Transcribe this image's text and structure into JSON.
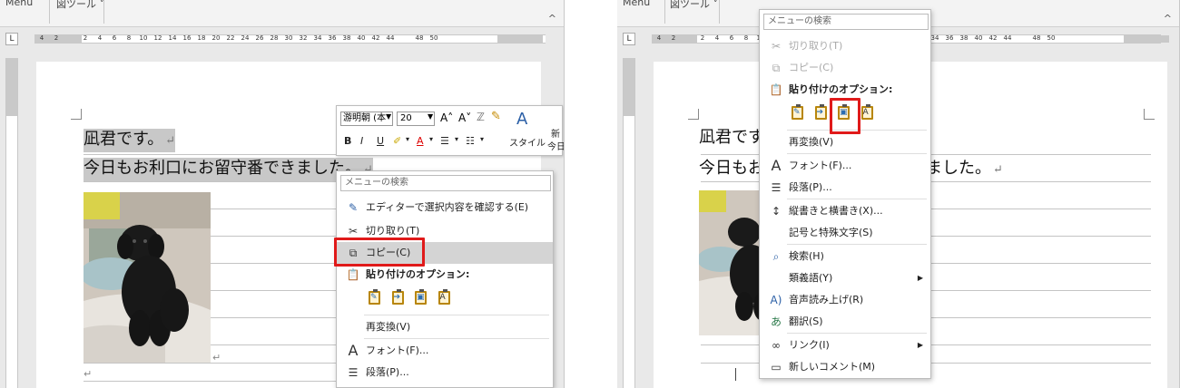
{
  "ribbon": {
    "menu_tab": "Menu ˅",
    "tools_tab": "図ツール ˅",
    "collapse": "^"
  },
  "ruler": {
    "corner": "L",
    "numbers": [
      "4",
      "2",
      "",
      "2",
      "4",
      "6",
      "8",
      "10",
      "12",
      "14",
      "16",
      "18",
      "20",
      "22",
      "24",
      "26",
      "28",
      "30",
      "32",
      "34",
      "36",
      "38",
      "40",
      "42",
      "44",
      "",
      "48",
      "50"
    ]
  },
  "document": {
    "line1": "凪君です。",
    "line2": "今日もお利口にお留守番できました。",
    "line1_right": "凪君です",
    "line2_right_a": "今日もお",
    "line2_right_b": "ました。",
    "para_mark": "↵"
  },
  "mini_toolbar": {
    "font_name": "游明朝 (本",
    "font_size": "20",
    "grow_font": "A˄",
    "shrink_font": "A˅",
    "bold": "B",
    "italic": "I",
    "underline": "U",
    "style_label": "スタイル",
    "new_comment_label": "新",
    "today_label": "今日"
  },
  "context_left": {
    "search_placeholder": "メニューの検索",
    "items": {
      "editor": "エディターで選択内容を確認する(E)",
      "cut": "切り取り(T)",
      "copy": "コピー(C)",
      "paste_options": "貼り付けのオプション:",
      "reconvert": "再変換(V)",
      "font": "フォント(F)...",
      "paragraph": "段落(P)..."
    }
  },
  "context_right": {
    "search_placeholder": "メニューの検索",
    "items": {
      "cut": "切り取り(T)",
      "copy": "コピー(C)",
      "paste_options": "貼り付けのオプション:",
      "reconvert": "再変換(V)",
      "font": "フォント(F)...",
      "paragraph": "段落(P)...",
      "text_direction": "縦書きと横書き(X)...",
      "symbols": "記号と特殊文字(S)",
      "search": "検索(H)",
      "synonyms": "類義語(Y)",
      "read_aloud": "音声読み上げ(R)",
      "translate": "翻訳(S)",
      "link": "リンク(I)",
      "new_comment": "新しいコメント(M)"
    }
  },
  "colors": {
    "highlight": "#e01a1a",
    "selection": "#c8c8c8"
  }
}
